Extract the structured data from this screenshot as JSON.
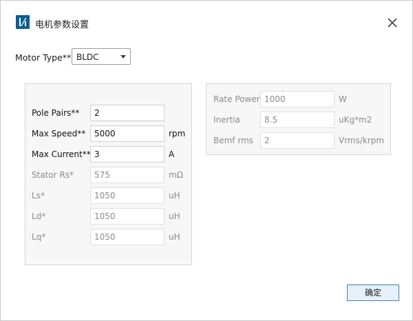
{
  "window": {
    "title": "电机参数设置"
  },
  "motor_type": {
    "label": "Motor Type**",
    "value": "BLDC"
  },
  "left_group": {
    "rows": [
      {
        "label": "Pole Pairs**",
        "value": "2",
        "unit": "",
        "enabled": true
      },
      {
        "label": "Max Speed**",
        "value": "5000",
        "unit": "rpm",
        "enabled": true
      },
      {
        "label": "Max Current**",
        "value": "3",
        "unit": "A",
        "enabled": true
      },
      {
        "label": "Stator Rs*",
        "value": "575",
        "unit": "mΩ",
        "enabled": false
      },
      {
        "label": "Ls*",
        "value": "1050",
        "unit": "uH",
        "enabled": false
      },
      {
        "label": "Ld*",
        "value": "1050",
        "unit": "uH",
        "enabled": false
      },
      {
        "label": "Lq*",
        "value": "1050",
        "unit": "uH",
        "enabled": false
      }
    ]
  },
  "right_group": {
    "rows": [
      {
        "label": "Rate Power",
        "value": "1000",
        "unit": "W",
        "enabled": false
      },
      {
        "label": "Inertia",
        "value": "8.5",
        "unit": "uKg*m2",
        "enabled": false
      },
      {
        "label": "Bemf rms",
        "value": "2",
        "unit": "Vrms/krpm",
        "enabled": false
      }
    ]
  },
  "buttons": {
    "ok": "确定"
  },
  "colors": {
    "logo": "#0e5e8e",
    "ok_border": "#3c7fb1",
    "ok_bg": "#e6f0f8",
    "disabled_text": "#8a8a8a"
  },
  "icons": {
    "app": "app-logo-icon",
    "close": "close-icon",
    "dropdown": "chevron-down-icon"
  }
}
